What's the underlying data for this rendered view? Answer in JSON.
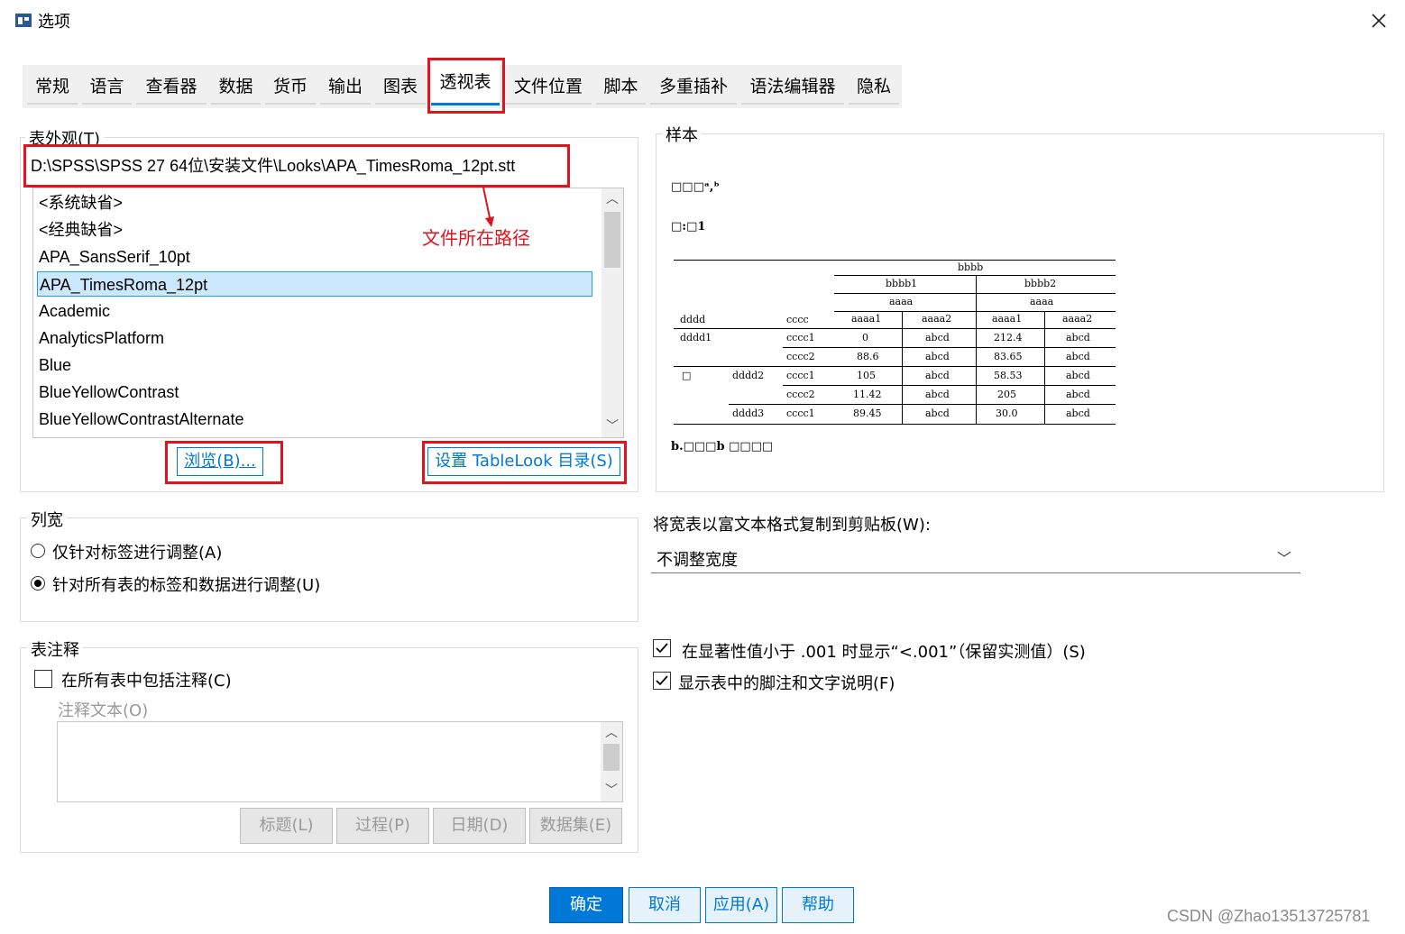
{
  "window": {
    "title": "选项",
    "close_glyph": "✕"
  },
  "tabs": [
    {
      "label": "常规"
    },
    {
      "label": "语言"
    },
    {
      "label": "查看器"
    },
    {
      "label": "数据"
    },
    {
      "label": "货币"
    },
    {
      "label": "输出"
    },
    {
      "label": "图表"
    },
    {
      "label": "透视表"
    },
    {
      "label": "文件位置"
    },
    {
      "label": "脚本"
    },
    {
      "label": "多重插补"
    },
    {
      "label": "语法编辑器"
    },
    {
      "label": "隐私"
    }
  ],
  "table_look": {
    "group_title": "表外观(T)",
    "path": "D:\\SPSS\\SPSS 27 64位\\安装文件\\Looks\\APA_TimesRoma_12pt.stt",
    "items": [
      {
        "label": "<系统缺省>"
      },
      {
        "label": "<经典缺省>"
      },
      {
        "label": "APA_SansSerif_10pt"
      },
      {
        "label": "APA_TimesRoma_12pt"
      },
      {
        "label": "Academic"
      },
      {
        "label": "AnalyticsPlatform"
      },
      {
        "label": "Blue"
      },
      {
        "label": "BlueYellowContrast"
      },
      {
        "label": "BlueYellowContrastAlternate"
      }
    ],
    "selected": "APA_TimesRoma_12pt",
    "browse_label": "浏览(B)...",
    "set_dir_label": "设置 TableLook 目录(S)"
  },
  "annotation": {
    "text": "文件所在路径",
    "color": "#e0141e"
  },
  "sample": {
    "group_title": "样本",
    "title_line": "□□□ᵃ,ᵇ",
    "subtitle_line": "□:□1",
    "header_top": "bbbb",
    "bbbb1": "bbbb1",
    "bbbb2": "bbbb2",
    "aaaa": "aaaa",
    "col_dddd": "dddd",
    "col_cccc": "cccc",
    "aaaa1": "aaaa1",
    "aaaa2": "aaaa2",
    "rows": [
      {
        "d1": "dddd1",
        "d2": "",
        "c": "cccc1",
        "v1": "0",
        "v2": "abcd",
        "v3": "212.4",
        "v4": "abcd"
      },
      {
        "d1": "",
        "d2": "",
        "c": "cccc2",
        "v1": "88.6",
        "v2": "abcd",
        "v3": "83.65",
        "v4": "abcd"
      },
      {
        "d1": "□",
        "d2": "dddd2",
        "c": "cccc1",
        "v1": "105",
        "v2": "abcd",
        "v3": "58.53",
        "v4": "abcd"
      },
      {
        "d1": "",
        "d2": "",
        "c": "cccc2",
        "v1": "11.42",
        "v2": "abcd",
        "v3": "205",
        "v4": "abcd"
      },
      {
        "d1": "",
        "d2": "dddd3",
        "c": "cccc1",
        "v1": "89.45",
        "v2": "abcd",
        "v3": "30.0",
        "v4": "abcd"
      }
    ],
    "footnote": "b.□□□b □□□□"
  },
  "copy_width": {
    "label": "将宽表以富文本格式复制到剪贴板(W):",
    "value": "不调整宽度"
  },
  "column_width": {
    "group_title": "列宽",
    "option_labels": "仅针对标签进行调整(A)",
    "option_all": "针对所有表的标签和数据进行调整(U)",
    "selected": "option_all"
  },
  "table_notes": {
    "group_title": "表注释",
    "include_label": "在所有表中包括注释(C)",
    "include_checked": false,
    "note_text_label": "注释文本(O)",
    "buttons": [
      "标题(L)",
      "过程(P)",
      "日期(D)",
      "数据集(E)"
    ]
  },
  "checks": {
    "sig_label": "在显著性值小于 .001 时显示“<.001”（保留实测值）(S)",
    "sig_checked": true,
    "footnote_label": "显示表中的脚注和文字说明(F)",
    "footnote_checked": true
  },
  "footer": {
    "ok": "确定",
    "cancel": "取消",
    "apply": "应用(A)",
    "help": "帮助"
  },
  "watermark": "CSDN @Zhao13513725781",
  "colors": {
    "accent": "#0078d7",
    "annotation": "#e0141e"
  }
}
